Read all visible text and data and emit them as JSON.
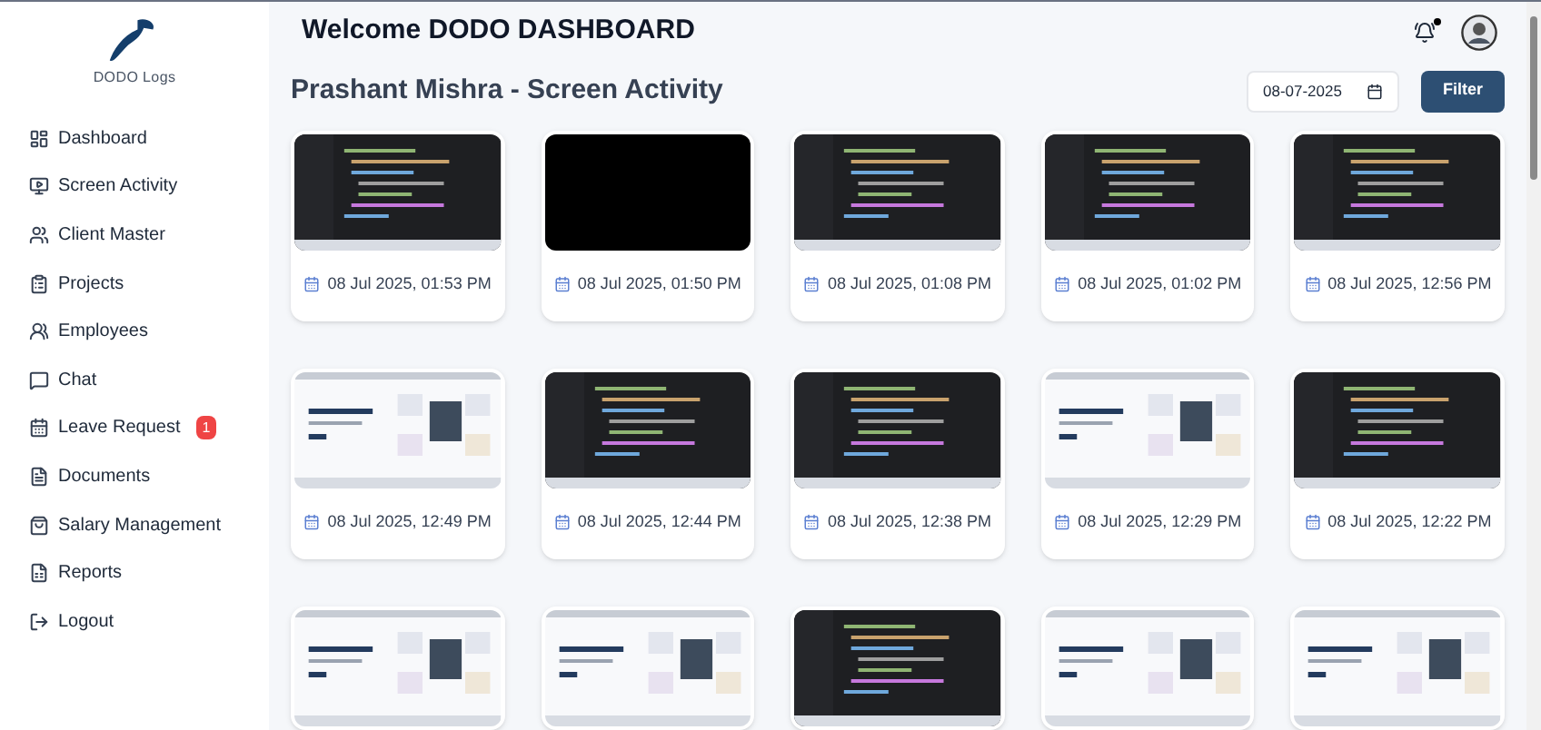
{
  "sidebar": {
    "logo_text": "DODO Logs",
    "items": [
      {
        "label": "Dashboard"
      },
      {
        "label": "Screen Activity"
      },
      {
        "label": "Client Master"
      },
      {
        "label": "Projects"
      },
      {
        "label": "Employees"
      },
      {
        "label": "Chat"
      },
      {
        "label": "Leave Request",
        "badge": "1"
      },
      {
        "label": "Documents"
      },
      {
        "label": "Salary Management"
      },
      {
        "label": "Reports"
      },
      {
        "label": "Logout"
      }
    ]
  },
  "header": {
    "title": "Welcome DODO DASHBOARD",
    "notification_dot": true
  },
  "page": {
    "title": "Prashant Mishra - Screen Activity",
    "date_field": {
      "value": "08-07-2025"
    },
    "filter_button": "Filter"
  },
  "screenshots": [
    {
      "kind": "dark",
      "time": "08 Jul 2025, 01:53 PM"
    },
    {
      "kind": "black",
      "time": "08 Jul 2025, 01:50 PM"
    },
    {
      "kind": "dark",
      "time": "08 Jul 2025, 01:08 PM"
    },
    {
      "kind": "dark",
      "time": "08 Jul 2025, 01:02 PM"
    },
    {
      "kind": "dark",
      "time": "08 Jul 2025, 12:56 PM"
    },
    {
      "kind": "light",
      "time": "08 Jul 2025, 12:49 PM"
    },
    {
      "kind": "dark",
      "time": "08 Jul 2025, 12:44 PM"
    },
    {
      "kind": "dark",
      "time": "08 Jul 2025, 12:38 PM"
    },
    {
      "kind": "light",
      "time": "08 Jul 2025, 12:29 PM"
    },
    {
      "kind": "dark",
      "time": "08 Jul 2025, 12:22 PM"
    },
    {
      "kind": "light"
    },
    {
      "kind": "light"
    },
    {
      "kind": "dark"
    },
    {
      "kind": "light"
    },
    {
      "kind": "light"
    }
  ]
}
